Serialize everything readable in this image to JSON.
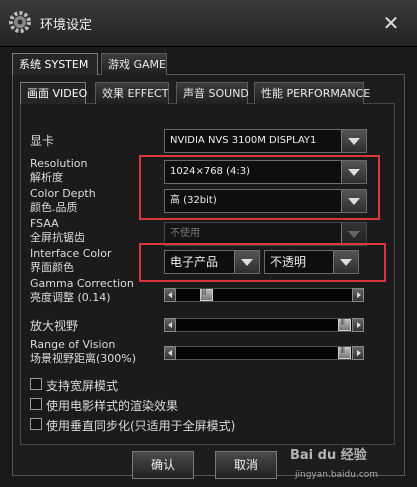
{
  "window": {
    "title": "环境设定",
    "close_symbol": "✕"
  },
  "tabs_main": [
    {
      "label": "系统 SYSTEM",
      "active": true
    },
    {
      "label": "游戏 GAME",
      "active": false
    }
  ],
  "tabs_sub": [
    {
      "label": "画面 VIDEO",
      "active": true
    },
    {
      "label": "效果 EFFECT",
      "active": false
    },
    {
      "label": "声音 SOUND",
      "active": false
    },
    {
      "label": "性能 PERFORMANCE",
      "active": false
    }
  ],
  "video": {
    "gpu": {
      "label": "显卡",
      "value": "NVIDIA NVS 3100M DISPLAY1"
    },
    "resolution": {
      "label_en": "Resolution",
      "label_cn": "解析度",
      "value": "1024×768 (4:3)"
    },
    "color_depth": {
      "label_en": "Color Depth",
      "label_cn": "颜色.品质",
      "value": "高 (32bit)"
    },
    "fsaa": {
      "label_en": "FSAA",
      "label_cn": "全屏抗锯齿",
      "value": "不使用"
    },
    "interface_color": {
      "label_en": "Interface Color",
      "label_cn": "界面颜色",
      "value": "电子产品",
      "opacity_value": "不透明"
    },
    "gamma": {
      "label_en": "Gamma Correction",
      "label_cn": "亮度调整 (0.14)",
      "fraction": 0.14
    },
    "zoom": {
      "label": "放大视野",
      "fraction": 1.0
    },
    "vision": {
      "label_en": "Range of Vision",
      "label_cn": "场景视野距离(300%)",
      "fraction": 1.0
    }
  },
  "options": [
    {
      "label": "支持宽屏模式",
      "checked": false
    },
    {
      "label": "使用电影样式的渲染效果",
      "checked": false
    },
    {
      "label": "使用垂直同步化(只适用于全屏模式)",
      "checked": false
    }
  ],
  "buttons": {
    "ok": "确认",
    "cancel": "取消"
  },
  "watermark": {
    "brand": "Bai du 经验",
    "url": "jingyan.baidu.com"
  },
  "colors": {
    "highlight": "#d9363e"
  }
}
